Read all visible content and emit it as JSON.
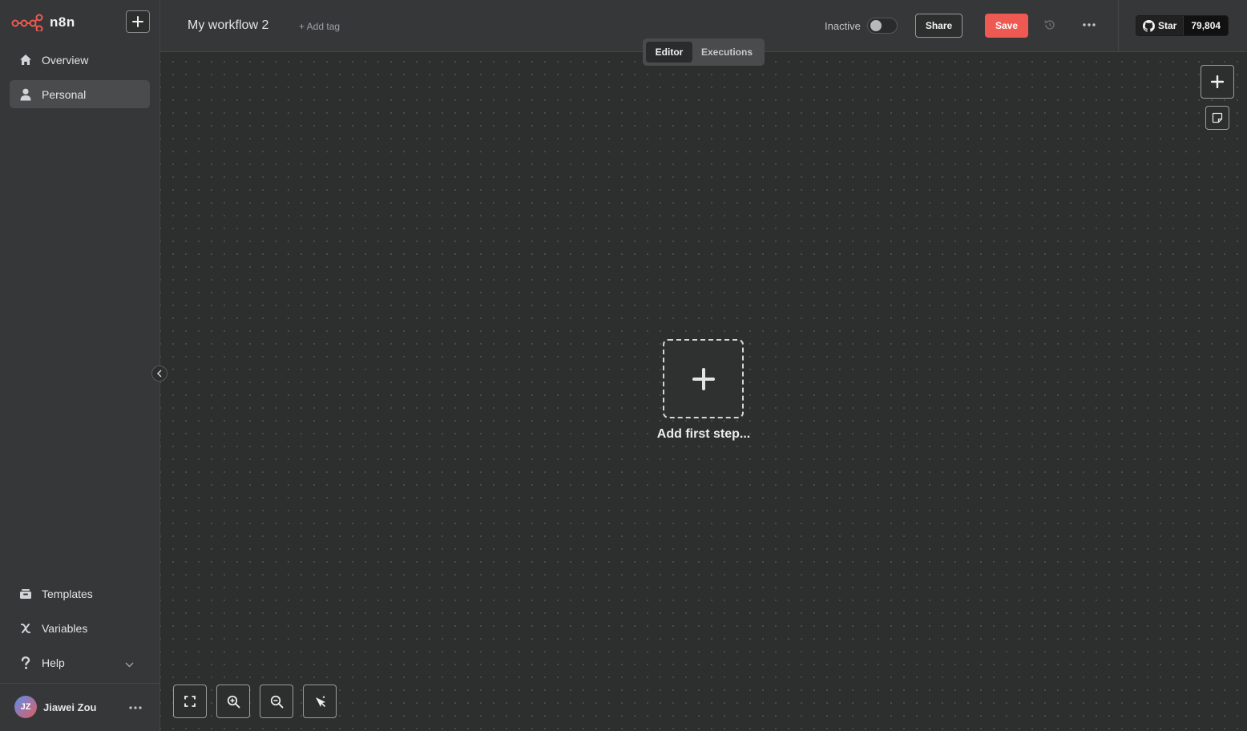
{
  "app": {
    "name": "n8n",
    "brand_color": "#ee5a52"
  },
  "sidebar": {
    "items": [
      {
        "label": "Overview",
        "icon": "home-icon"
      },
      {
        "label": "Personal",
        "icon": "user-icon",
        "active": true
      }
    ],
    "bottom_items": [
      {
        "label": "Templates",
        "icon": "templates-icon"
      },
      {
        "label": "Variables",
        "icon": "variables-icon"
      },
      {
        "label": "Help",
        "icon": "question-icon"
      }
    ],
    "user": {
      "initials": "JZ",
      "name": "Jiawei Zou"
    }
  },
  "header": {
    "workflow_name": "My workflow 2",
    "add_tag": "+ Add tag",
    "status_label": "Inactive",
    "share_label": "Share",
    "save_label": "Save",
    "github": {
      "star_label": "Star",
      "count": "79,804"
    }
  },
  "tabs": [
    {
      "label": "Editor",
      "active": true
    },
    {
      "label": "Executions"
    }
  ],
  "canvas": {
    "first_step_label": "Add first step..."
  }
}
